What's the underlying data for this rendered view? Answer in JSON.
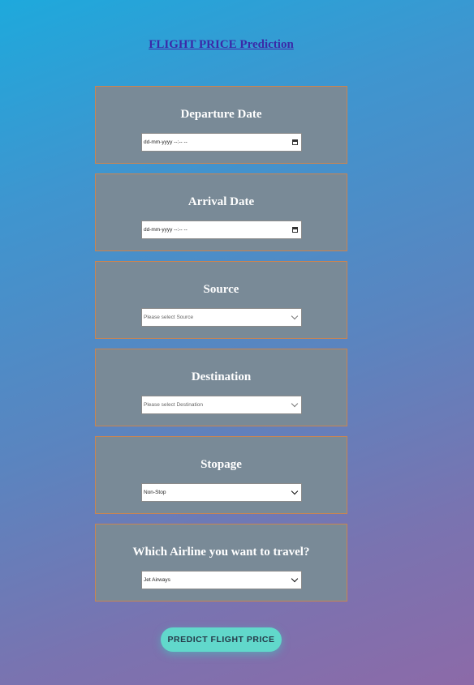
{
  "page": {
    "title": "FLIGHT PRICE Prediction"
  },
  "form": {
    "departure": {
      "label": "Departure Date",
      "value": "dd-mm-yyyy  --:-- --"
    },
    "arrival": {
      "label": "Arrival Date",
      "value": "dd-mm-yyyy  --:-- --"
    },
    "source": {
      "label": "Source",
      "selected": "Please select Source"
    },
    "destination": {
      "label": "Destination",
      "selected": "Please select Destination"
    },
    "stopage": {
      "label": "Stopage",
      "selected": "Non-Stop"
    },
    "airline": {
      "label": "Which Airline you want to travel?",
      "selected": "Jet Airways"
    },
    "submit_label": "PREDICT FLIGHT PRICE"
  },
  "colors": {
    "card_bg": "#798a97",
    "card_border": "#c98552",
    "button_bg": "#61d8cb",
    "title_link": "#3b2aa8"
  },
  "icons": {
    "date_picker": "calendar-icon",
    "select": "chevron-down-icon"
  }
}
